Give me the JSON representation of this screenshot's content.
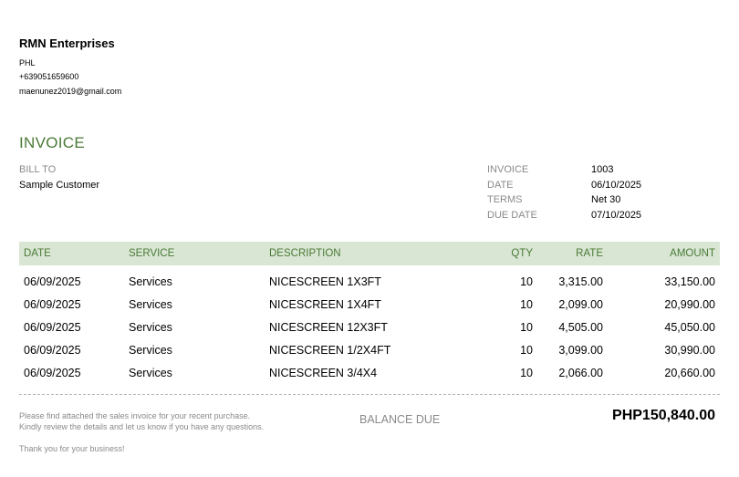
{
  "company": {
    "name": "RMN Enterprises",
    "country": "PHL",
    "phone": "+639051659600",
    "email": "maenunez2019@gmail.com"
  },
  "invoice": {
    "title": "INVOICE",
    "bill_to_label": "BILL TO",
    "bill_to_name": "Sample Customer",
    "meta": [
      {
        "label": "INVOICE",
        "value": "1003"
      },
      {
        "label": "DATE",
        "value": "06/10/2025"
      },
      {
        "label": "TERMS",
        "value": "Net 30"
      },
      {
        "label": "DUE DATE",
        "value": "07/10/2025"
      }
    ]
  },
  "table": {
    "headers": {
      "date": "DATE",
      "service": "SERVICE",
      "description": "DESCRIPTION",
      "qty": "QTY",
      "rate": "RATE",
      "amount": "AMOUNT"
    },
    "rows": [
      {
        "date": "06/09/2025",
        "service": "Services",
        "description": "NICESCREEN 1X3FT",
        "qty": "10",
        "rate": "3,315.00",
        "amount": "33,150.00"
      },
      {
        "date": "06/09/2025",
        "service": "Services",
        "description": "NICESCREEN 1X4FT",
        "qty": "10",
        "rate": "2,099.00",
        "amount": "20,990.00"
      },
      {
        "date": "06/09/2025",
        "service": "Services",
        "description": "NICESCREEN 12X3FT",
        "qty": "10",
        "rate": "4,505.00",
        "amount": "45,050.00"
      },
      {
        "date": "06/09/2025",
        "service": "Services",
        "description": "NICESCREEN 1/2X4FT",
        "qty": "10",
        "rate": "3,099.00",
        "amount": "30,990.00"
      },
      {
        "date": "06/09/2025",
        "service": "Services",
        "description": "NICESCREEN 3/4X4",
        "qty": "10",
        "rate": "2,066.00",
        "amount": "20,660.00"
      }
    ]
  },
  "footer": {
    "note_line1": "Please find attached the sales invoice for your recent purchase.",
    "note_line2": "Kindly review the details and let us know if you have any questions.",
    "balance_label": "BALANCE DUE",
    "balance_value": "PHP150,840.00",
    "thanks": "Thank you for your business!"
  },
  "colors": {
    "accent": "#4a7a35",
    "header_bg": "#d9e6d4",
    "muted": "#8a8a8a"
  }
}
